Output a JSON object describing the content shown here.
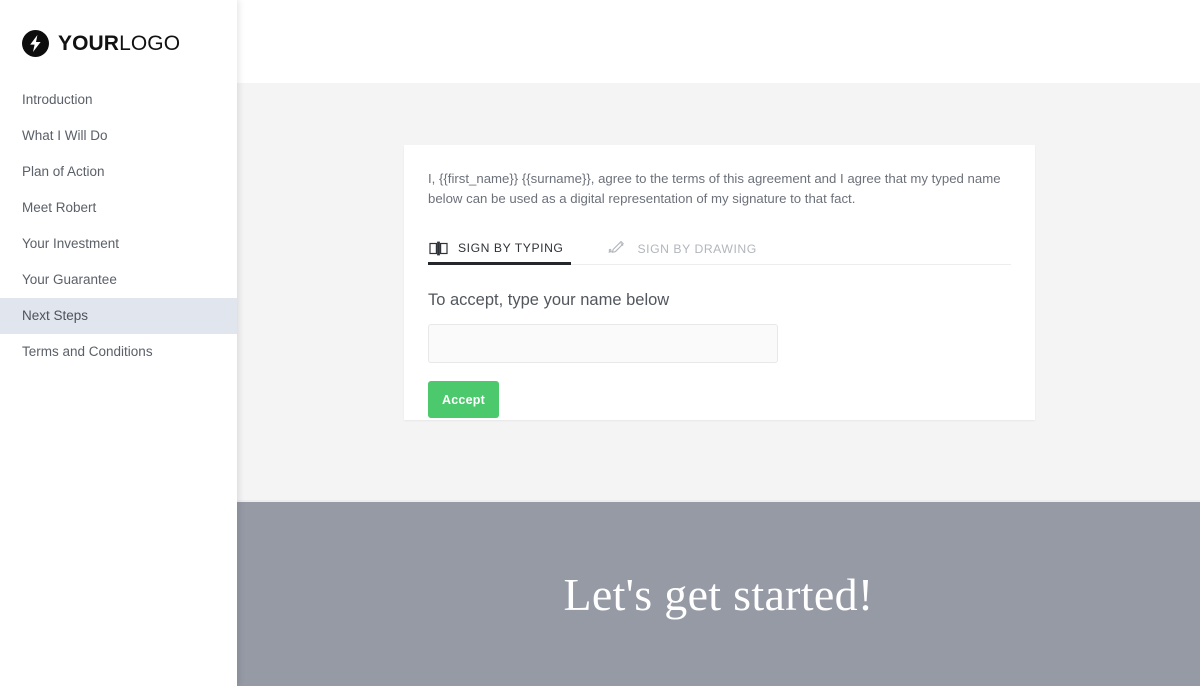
{
  "brand": {
    "logo_strong": "YOUR",
    "logo_light": "LOGO",
    "logo_icon": "lightning-bolt-icon"
  },
  "sidebar": {
    "items": [
      {
        "label": "Introduction",
        "active": false
      },
      {
        "label": "What I Will Do",
        "active": false
      },
      {
        "label": "Plan of Action",
        "active": false
      },
      {
        "label": "Meet Robert",
        "active": false
      },
      {
        "label": "Your Investment",
        "active": false
      },
      {
        "label": "Your Guarantee",
        "active": false
      },
      {
        "label": "Next Steps",
        "active": true
      },
      {
        "label": "Terms and Conditions",
        "active": false
      }
    ],
    "active_item": "Next Steps"
  },
  "signature_card": {
    "agreement_text": "I, {{first_name}} {{surname}}, agree to the terms of this agreement and I agree that my typed name below can be used as a digital representation of my signature to that fact.",
    "tabs": [
      {
        "label": "SIGN BY TYPING",
        "icon": "keyboard-icon",
        "active": true
      },
      {
        "label": "SIGN BY DRAWING",
        "icon": "pen-signature-icon",
        "active": false
      }
    ],
    "accept_label": "To accept, type your name below",
    "name_input_value": "",
    "name_input_placeholder": "",
    "accept_button_label": "Accept"
  },
  "footer": {
    "hero_title": "Let's get started!"
  },
  "colors": {
    "accent_green": "#4cc86d",
    "footer_background": "#959aa5",
    "content_background": "#f4f4f4",
    "sidebar_active": "#e1e5ee",
    "tab_underline": "#23272c"
  }
}
